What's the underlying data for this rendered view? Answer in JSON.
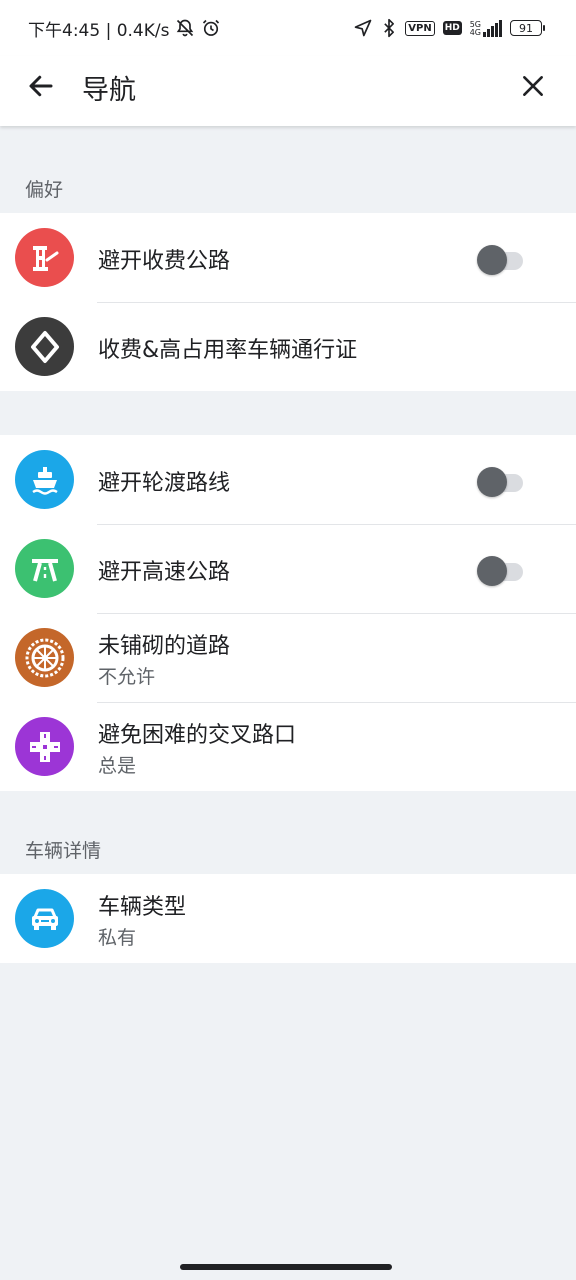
{
  "status_bar": {
    "time_speed": "下午4:45 | 0.4K/s",
    "vpn_label": "VPN",
    "hd_label": "HD",
    "network_label_top": "5G",
    "network_label_bottom": "4G",
    "battery_level": "91"
  },
  "app_bar": {
    "title": "导航",
    "back_icon": "arrow-left-icon",
    "close_icon": "close-icon"
  },
  "sections": {
    "preferences": {
      "header": "偏好",
      "items": [
        {
          "label": "避开收费公路",
          "icon": "toll-gate-icon",
          "icon_color": "#ea4e4e",
          "toggle_on": false
        },
        {
          "label": "收费&高占用率车辆通行证",
          "icon": "diamond-lane-icon",
          "icon_color": "#3c3c3c"
        }
      ]
    },
    "avoid": {
      "items": [
        {
          "label": "避开轮渡路线",
          "icon": "ferry-icon",
          "icon_color": "#1ba7e8",
          "toggle_on": false
        },
        {
          "label": "避开高速公路",
          "icon": "highway-icon",
          "icon_color": "#3cc171",
          "toggle_on": false
        },
        {
          "label": "未铺砌的道路",
          "sub": "不允许",
          "icon": "wheel-icon",
          "icon_color": "#c4672a"
        },
        {
          "label": "避免困难的交叉路口",
          "sub": "总是",
          "icon": "intersection-icon",
          "icon_color": "#9c35d6"
        }
      ]
    },
    "vehicle": {
      "header": "车辆详情",
      "items": [
        {
          "label": "车辆类型",
          "sub": "私有",
          "icon": "car-icon",
          "icon_color": "#1ba7e8"
        }
      ]
    }
  }
}
